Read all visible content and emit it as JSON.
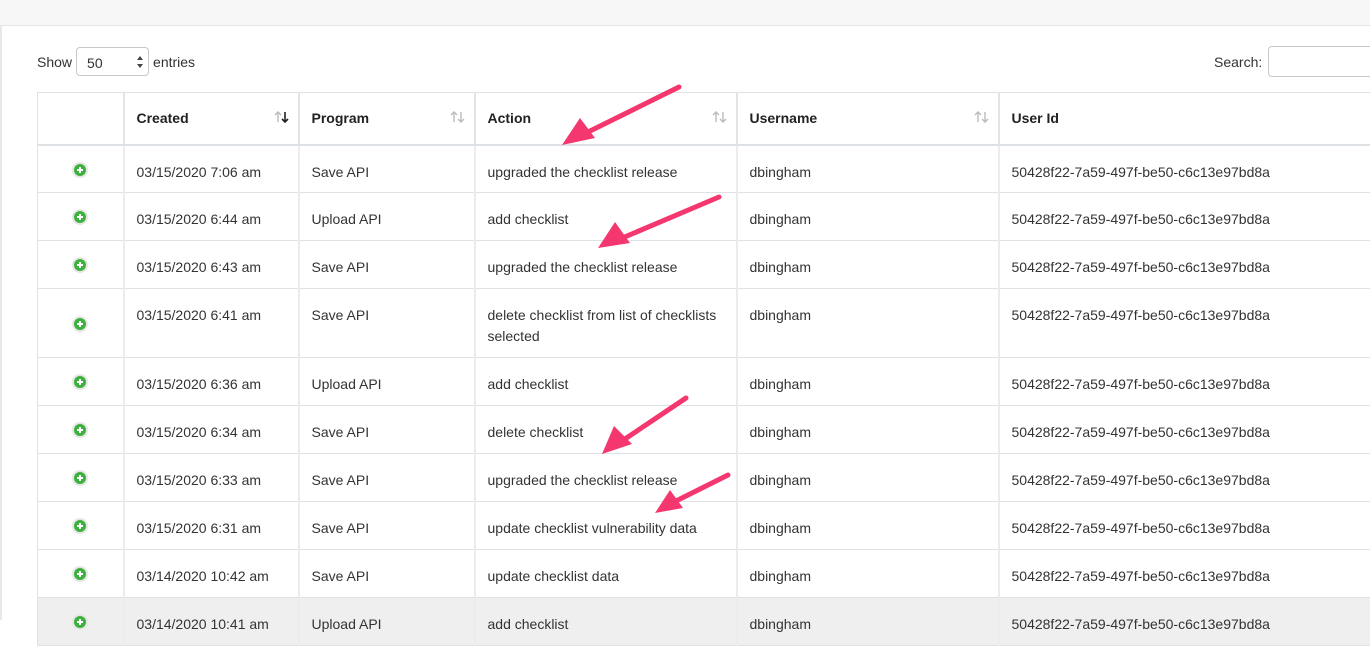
{
  "length": {
    "show_label": "Show",
    "value": "50",
    "entries_label": "entries"
  },
  "search": {
    "label": "Search:",
    "value": ""
  },
  "columns": [
    "",
    "Created",
    "Program",
    "Action",
    "Username",
    "User Id"
  ],
  "rows": [
    {
      "created": "03/15/2020 7:06 am",
      "program": "Save API",
      "action": "upgraded the checklist release",
      "username": "dbingham",
      "user_id": "50428f22-7a59-497f-be50-c6c13e97bd8a"
    },
    {
      "created": "03/15/2020 6:44 am",
      "program": "Upload API",
      "action": "add checklist",
      "username": "dbingham",
      "user_id": "50428f22-7a59-497f-be50-c6c13e97bd8a"
    },
    {
      "created": "03/15/2020 6:43 am",
      "program": "Save API",
      "action": "upgraded the checklist release",
      "username": "dbingham",
      "user_id": "50428f22-7a59-497f-be50-c6c13e97bd8a"
    },
    {
      "created": "03/15/2020 6:41 am",
      "program": "Save API",
      "action": "delete checklist from list of checklists selected",
      "username": "dbingham",
      "user_id": "50428f22-7a59-497f-be50-c6c13e97bd8a"
    },
    {
      "created": "03/15/2020 6:36 am",
      "program": "Upload API",
      "action": "add checklist",
      "username": "dbingham",
      "user_id": "50428f22-7a59-497f-be50-c6c13e97bd8a"
    },
    {
      "created": "03/15/2020 6:34 am",
      "program": "Save API",
      "action": "delete checklist",
      "username": "dbingham",
      "user_id": "50428f22-7a59-497f-be50-c6c13e97bd8a"
    },
    {
      "created": "03/15/2020 6:33 am",
      "program": "Save API",
      "action": "upgraded the checklist release",
      "username": "dbingham",
      "user_id": "50428f22-7a59-497f-be50-c6c13e97bd8a"
    },
    {
      "created": "03/15/2020 6:31 am",
      "program": "Save API",
      "action": "update checklist vulnerability data",
      "username": "dbingham",
      "user_id": "50428f22-7a59-497f-be50-c6c13e97bd8a"
    },
    {
      "created": "03/14/2020 10:42 am",
      "program": "Save API",
      "action": "update checklist data",
      "username": "dbingham",
      "user_id": "50428f22-7a59-497f-be50-c6c13e97bd8a"
    },
    {
      "created": "03/14/2020 10:41 am",
      "program": "Upload API",
      "action": "add checklist",
      "username": "dbingham",
      "user_id": "50428f22-7a59-497f-be50-c6c13e97bd8a"
    }
  ],
  "colors": {
    "accent_arrow": "#f5376f",
    "expand_icon": "#3cb13c",
    "border": "#dee2e6",
    "shaded_row": "#efefef"
  },
  "icons": {
    "expand": "plus-circle-icon",
    "sort": "sort-arrows-icon"
  }
}
